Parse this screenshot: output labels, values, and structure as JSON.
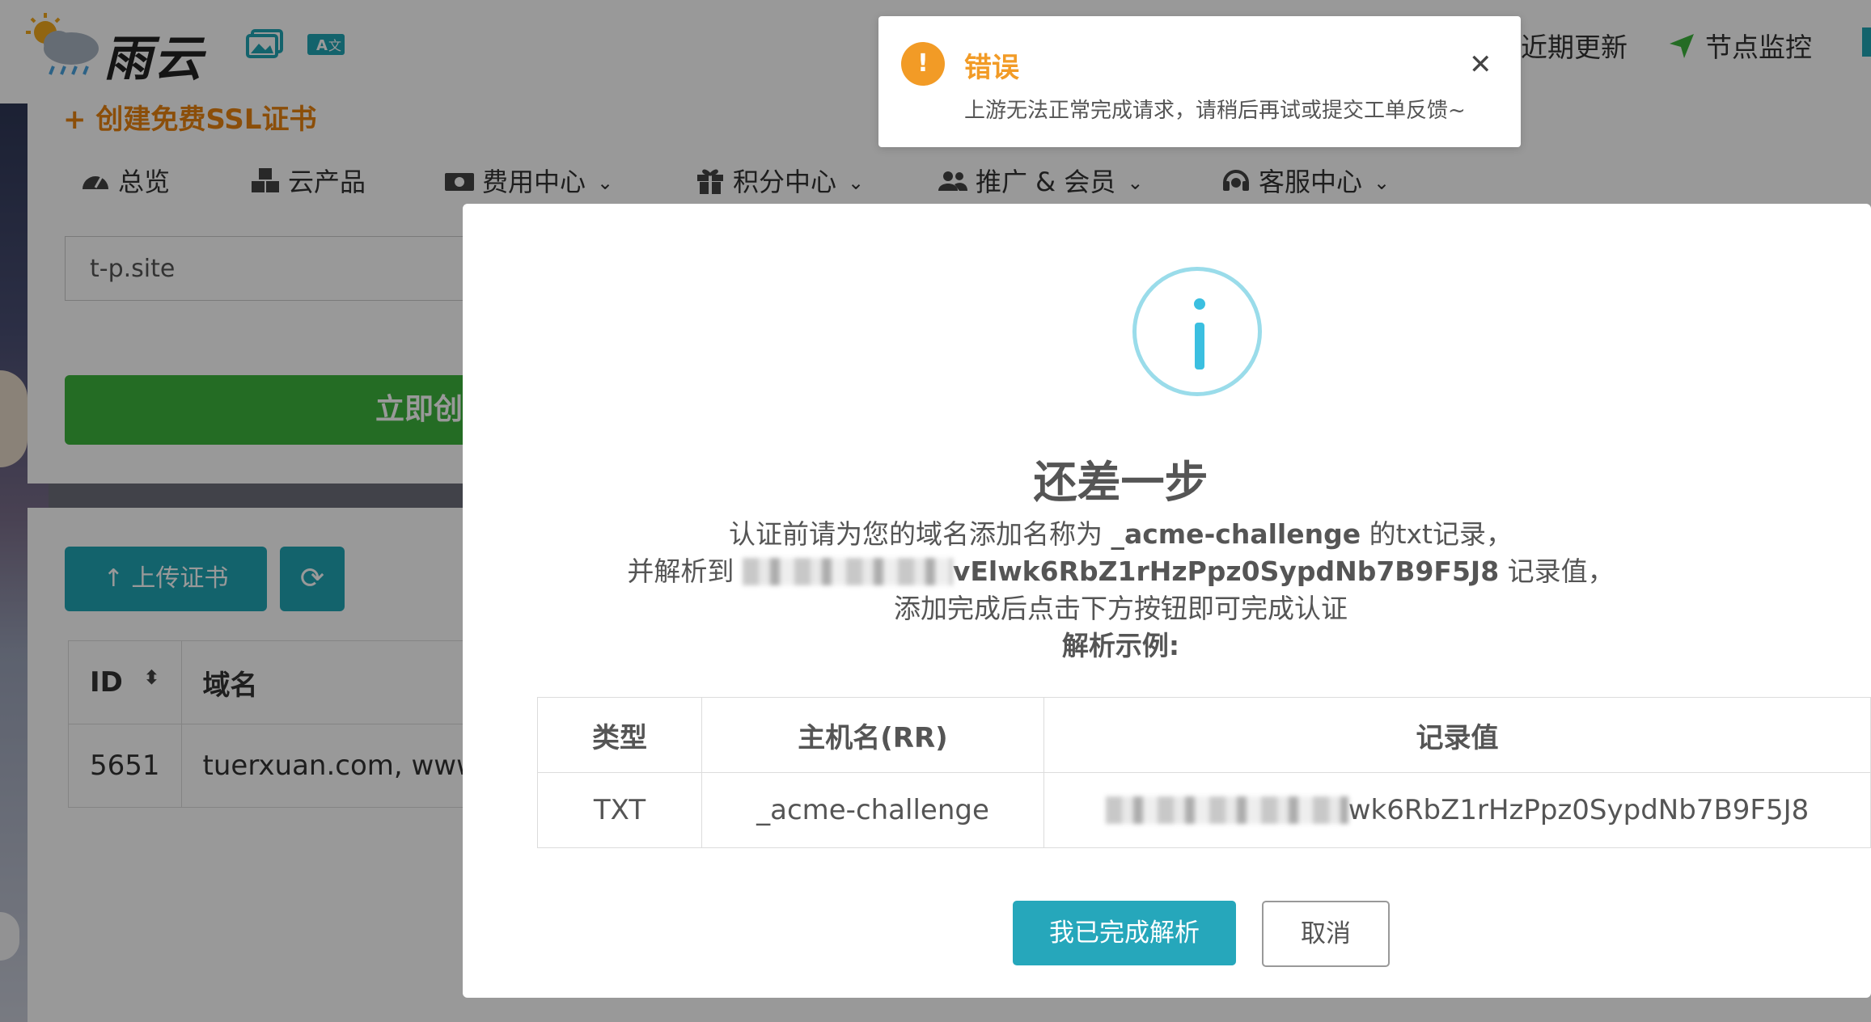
{
  "header": {
    "brand": "雨云",
    "links": [
      {
        "label": "近期更新",
        "icon": "none"
      },
      {
        "label": "节点监控",
        "icon": "location-arrow-icon"
      }
    ]
  },
  "page": {
    "create_link": "创建免费SSL证书",
    "domain_value": "t-p.site",
    "create_button": "立即创",
    "upload_button": "上传证书"
  },
  "nav": {
    "items": [
      {
        "label": "总览",
        "icon": "dashboard-icon"
      },
      {
        "label": "云产品",
        "icon": "cubes-icon"
      },
      {
        "label": "费用中心",
        "icon": "money-icon"
      },
      {
        "label": "积分中心",
        "icon": "gift-icon"
      },
      {
        "label": "推广 & 会员",
        "icon": "users-icon"
      },
      {
        "label": "客服中心",
        "icon": "headset-icon"
      }
    ]
  },
  "cert_table": {
    "headers": [
      "ID",
      "域名"
    ],
    "rows": [
      [
        "5651",
        "tuerxuan.com, www"
      ]
    ]
  },
  "modal": {
    "title": "还差一步",
    "line1_prefix": "认证前请为您的域名添加名称为",
    "line1_name": "_acme-challenge",
    "line1_suffix": "的txt记录，",
    "line2_prefix": "并解析到",
    "line2_value": "vElwk6RbZ1rHzPpz0SypdNb7B9F5J8",
    "line2_suffix": "记录值，",
    "line3": "添加完成后点击下方按钮即可完成认证",
    "example_heading": "解析示例:",
    "example_table": {
      "headers": [
        "类型",
        "主机名(RR)",
        "记录值"
      ],
      "rows": [
        [
          "TXT",
          "_acme-challenge",
          "wk6RbZ1rHzPpz0SypdNb7B9F5J8"
        ]
      ]
    },
    "confirm_button": "我已完成解析",
    "cancel_button": "取消"
  },
  "toast": {
    "title": "错误",
    "message": "上游无法正常完成请求，请稍后再试或提交工单反馈~",
    "type_color": "#f29b26"
  }
}
